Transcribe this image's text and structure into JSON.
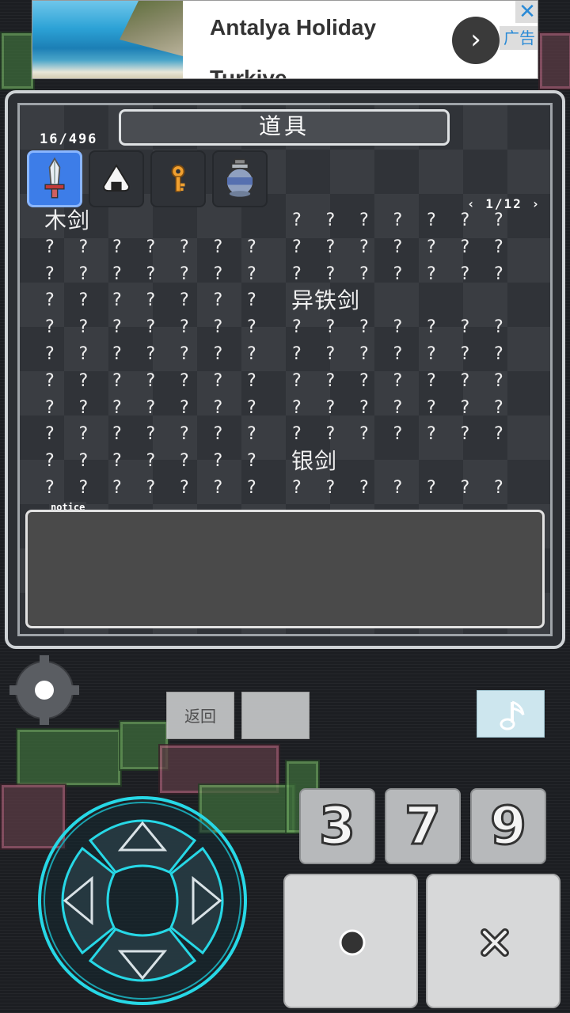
{
  "ad": {
    "title": "Antalya Holiday",
    "subtitle": "Turkiye",
    "label": "广告",
    "close_glyph": "✕",
    "arrow_glyph": "›"
  },
  "inventory": {
    "title": "道具",
    "count": "16/496",
    "page": "1/12",
    "page_prev_glyph": "‹",
    "page_next_glyph": "›",
    "categories": [
      {
        "icon": "sword-icon",
        "active": true
      },
      {
        "icon": "onigiri-icon",
        "active": false
      },
      {
        "icon": "key-icon",
        "active": false
      },
      {
        "icon": "pot-icon",
        "active": false
      }
    ],
    "left_column": [
      "木剑",
      "? ? ? ? ? ? ?",
      "? ? ? ? ? ? ?",
      "? ? ? ? ? ? ?",
      "? ? ? ? ? ? ?",
      "? ? ? ? ? ? ?",
      "? ? ? ? ? ? ?",
      "? ? ? ? ? ? ?",
      "? ? ? ? ? ? ?",
      "? ? ? ? ? ? ?",
      "? ? ? ? ? ? ?"
    ],
    "right_column": [
      "? ? ? ? ? ? ?",
      "? ? ? ? ? ? ?",
      "? ? ? ? ? ? ?",
      "异铁剑",
      "? ? ? ? ? ? ?",
      "? ? ? ? ? ? ?",
      "? ? ? ? ? ? ?",
      "? ? ? ? ? ? ?",
      "? ? ? ? ? ? ?",
      "银剑",
      "? ? ? ? ? ? ?"
    ],
    "notice_label": "notice",
    "notice_text": ""
  },
  "controls": {
    "back_label": "返回",
    "blank_label": "",
    "num_buttons": [
      "3",
      "7",
      "9"
    ],
    "icons": {
      "settings": "gear-icon",
      "music": "music-note-icon",
      "confirm": "circle-icon",
      "cancel": "cross-icon",
      "dpad": "dpad-icon"
    }
  },
  "colors": {
    "accent": "#3d7de8",
    "dpad_glow": "#27d8e6"
  }
}
